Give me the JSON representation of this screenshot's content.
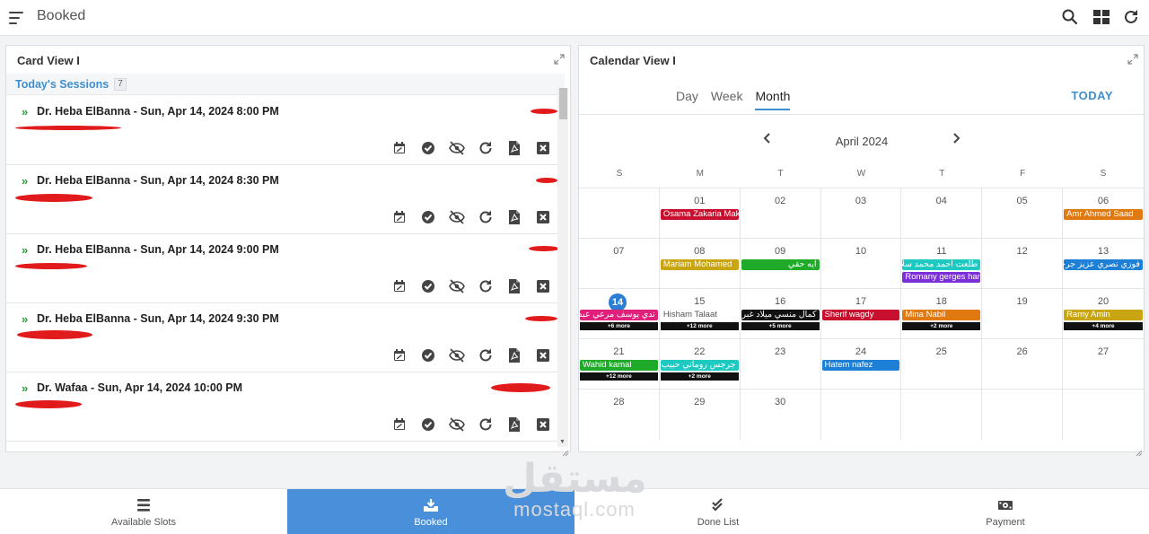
{
  "header": {
    "title": "Booked",
    "icons": [
      "menu-icon",
      "search-icon",
      "grid-icon",
      "refresh-icon"
    ]
  },
  "card_view": {
    "title": "Card View I",
    "sessions_label": "Today's Sessions",
    "sessions_count": "7",
    "sessions": [
      {
        "title": "Dr. Heba ElBanna - Sun, Apr 14, 2024 8:00 PM"
      },
      {
        "title": "Dr. Heba ElBanna - Sun, Apr 14, 2024 8:30 PM"
      },
      {
        "title": "Dr. Heba ElBanna - Sun, Apr 14, 2024 9:00 PM"
      },
      {
        "title": "Dr. Heba ElBanna - Sun, Apr 14, 2024 9:30 PM"
      },
      {
        "title": "Dr. Wafaa - Sun, Apr 14, 2024 10:00 PM"
      }
    ],
    "action_icons": [
      "calendar-edit-icon",
      "check-circle-icon",
      "eye-off-icon",
      "redo-icon",
      "pdf-file-icon",
      "close-box-icon"
    ]
  },
  "calendar_view": {
    "title": "Calendar View I",
    "tabs": [
      "Day",
      "Week",
      "Month"
    ],
    "active_tab": "Month",
    "today_label": "TODAY",
    "month_label": "April 2024",
    "weekdays": [
      "S",
      "M",
      "T",
      "W",
      "T",
      "F",
      "S"
    ],
    "today": "14",
    "weeks": [
      [
        {
          "d": ""
        },
        {
          "d": "01",
          "events": [
            {
              "t": "Osama Zakaria Mak",
              "c": "#c8102e"
            }
          ]
        },
        {
          "d": "02"
        },
        {
          "d": "03"
        },
        {
          "d": "04"
        },
        {
          "d": "05"
        },
        {
          "d": "06",
          "events": [
            {
              "t": "Amr Ahmed Saad",
              "c": "#e07a10"
            }
          ]
        }
      ],
      [
        {
          "d": "07"
        },
        {
          "d": "08",
          "events": [
            {
              "t": "Mariam Mohamed",
              "c": "#c9a512"
            }
          ]
        },
        {
          "d": "09",
          "events": [
            {
              "t": "ايه حقي",
              "c": "#1faa2a"
            }
          ]
        },
        {
          "d": "10"
        },
        {
          "d": "11",
          "events": [
            {
              "t": "طلعت احمد محمد سلام",
              "c": "#1ec9c2"
            },
            {
              "t": "Romany gerges han",
              "c": "#7b2fd9"
            }
          ]
        },
        {
          "d": "12"
        },
        {
          "d": "13",
          "events": [
            {
              "t": "فوزي نصري عزيز جرجس",
              "c": "#1e7fd6"
            }
          ]
        }
      ],
      [
        {
          "d": "14",
          "events": [
            {
              "t": "ندي يوسف مرعي عبدالرحمن",
              "c": "#e0207a"
            },
            {
              "t": "+6 more",
              "c": "more"
            }
          ]
        },
        {
          "d": "15",
          "events": [
            {
              "t": "Hisham Talaat",
              "c": "plain"
            },
            {
              "t": "+12 more",
              "c": "more"
            }
          ]
        },
        {
          "d": "16",
          "events": [
            {
              "t": "كمال منسي ميلاد غبريال",
              "c": "#111111"
            },
            {
              "t": "+5 more",
              "c": "more"
            }
          ]
        },
        {
          "d": "17",
          "events": [
            {
              "t": "Sherif wagdy",
              "c": "#c8102e"
            }
          ]
        },
        {
          "d": "18",
          "events": [
            {
              "t": "Mina Nabil",
              "c": "#e07a10"
            },
            {
              "t": "+2 more",
              "c": "more"
            }
          ]
        },
        {
          "d": "19"
        },
        {
          "d": "20",
          "events": [
            {
              "t": "Ramy Amin",
              "c": "#c9a512"
            },
            {
              "t": "+4 more",
              "c": "more"
            }
          ]
        }
      ],
      [
        {
          "d": "21",
          "events": [
            {
              "t": "Wahid kamal",
              "c": "#1faa2a"
            },
            {
              "t": "+12 more",
              "c": "more"
            }
          ]
        },
        {
          "d": "22",
          "events": [
            {
              "t": "جرجس روماني حبيب",
              "c": "#1ec9c2"
            },
            {
              "t": "+2 more",
              "c": "more"
            }
          ]
        },
        {
          "d": "23"
        },
        {
          "d": "24",
          "events": [
            {
              "t": "Hatem nafez",
              "c": "#1e7fd6"
            }
          ]
        },
        {
          "d": "25"
        },
        {
          "d": "26"
        },
        {
          "d": "27"
        }
      ],
      [
        {
          "d": "28"
        },
        {
          "d": "29"
        },
        {
          "d": "30"
        },
        {
          "d": ""
        },
        {
          "d": ""
        },
        {
          "d": ""
        },
        {
          "d": ""
        }
      ]
    ]
  },
  "bottom_nav": {
    "items": [
      {
        "label": "Available Slots",
        "icon": "list-icon"
      },
      {
        "label": "Booked",
        "icon": "download-tray-icon",
        "active": true
      },
      {
        "label": "Done List",
        "icon": "double-check-icon"
      },
      {
        "label": "Payment",
        "icon": "money-icon"
      }
    ]
  },
  "watermark": {
    "arabic": "مستقل",
    "latin": "mostaql.com"
  },
  "colors": {
    "accent": "#3d8fd1",
    "active_nav": "#4a8fd9",
    "today_badge": "#2a7fd4",
    "chevron_green": "#2e9b3c"
  }
}
